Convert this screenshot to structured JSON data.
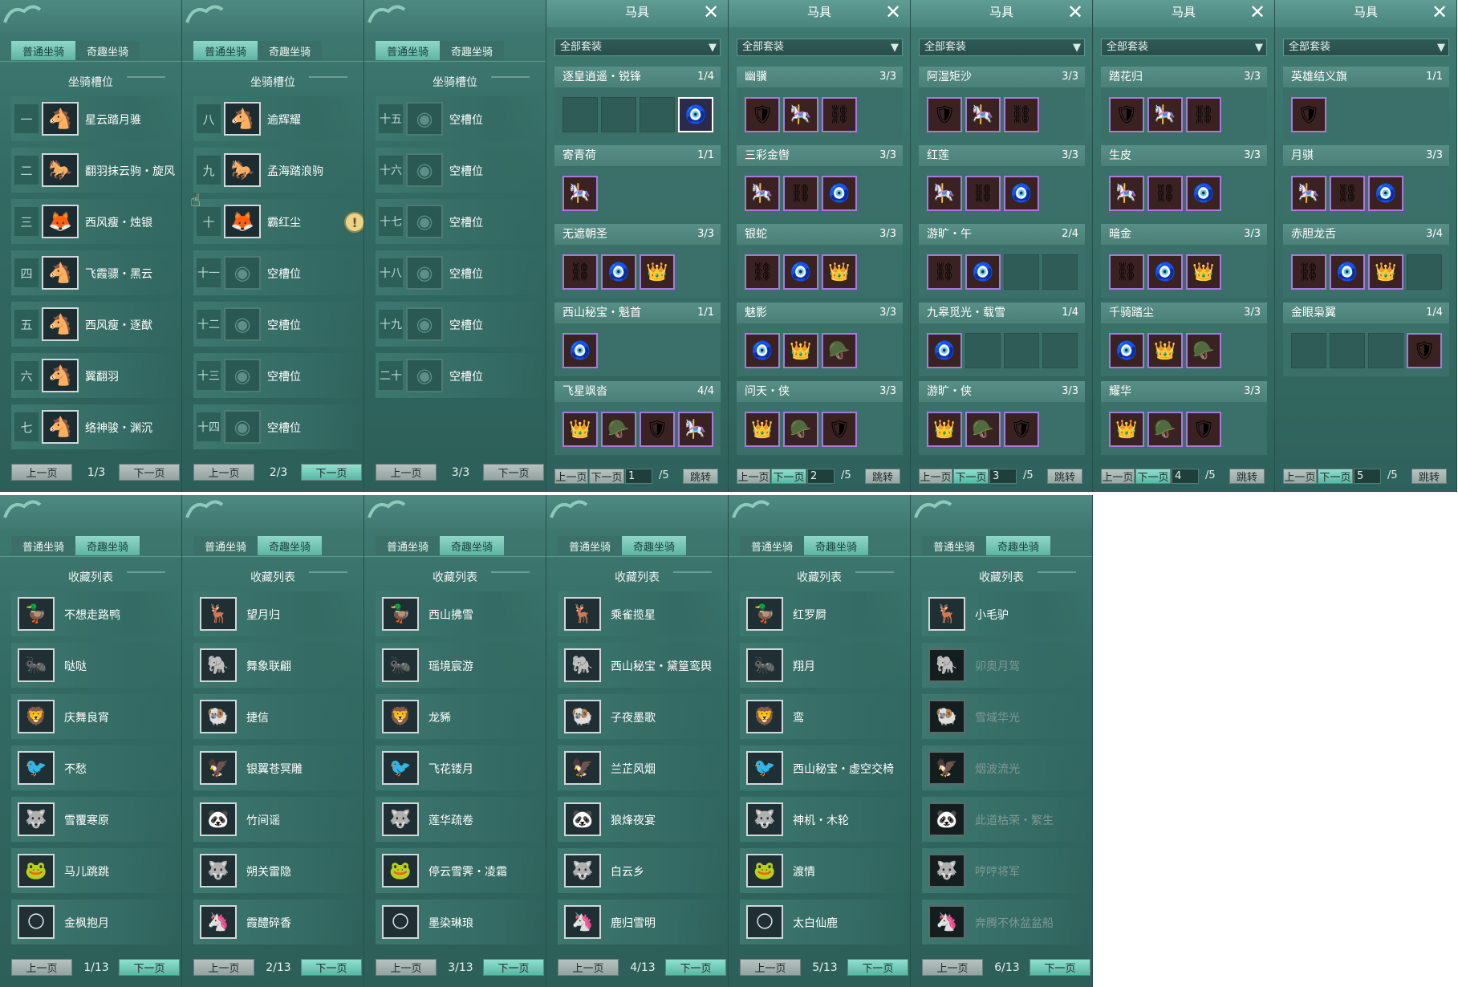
{
  "tabs": {
    "normal": "普通坐骑",
    "fun": "奇趣坐骑"
  },
  "slot_title": "坐骑槽位",
  "collect_title": "收藏列表",
  "prev": "上一页",
  "next": "下一页",
  "goto": "跳转",
  "gear_title": "马具",
  "gear_filter": "全部套装",
  "gear_total": "/5",
  "alert_icon": "!",
  "close_icon": "✕",
  "slot_pages": [
    {
      "page": "1/3",
      "slots": [
        {
          "num": "一",
          "name": "星云踏月骓"
        },
        {
          "num": "二",
          "name": "翻羽抹云驹・旋风"
        },
        {
          "num": "三",
          "name": "西风瘦・烛银"
        },
        {
          "num": "四",
          "name": "飞霞骠・黑云"
        },
        {
          "num": "五",
          "name": "西风瘦・逐猷"
        },
        {
          "num": "六",
          "name": "翼翻羽"
        },
        {
          "num": "七",
          "name": "络神骏・渊沉"
        }
      ]
    },
    {
      "page": "2/3",
      "slots": [
        {
          "num": "八",
          "name": "逾辉耀"
        },
        {
          "num": "九",
          "name": "孟海踏浪驹"
        },
        {
          "num": "十",
          "name": "霸红尘"
        },
        {
          "num": "十一",
          "name": "空槽位"
        },
        {
          "num": "十二",
          "name": "空槽位"
        },
        {
          "num": "十三",
          "name": "空槽位"
        },
        {
          "num": "十四",
          "name": "空槽位"
        }
      ]
    },
    {
      "page": "3/3",
      "slots": [
        {
          "num": "十五",
          "name": "空槽位"
        },
        {
          "num": "十六",
          "name": "空槽位"
        },
        {
          "num": "十七",
          "name": "空槽位"
        },
        {
          "num": "十八",
          "name": "空槽位"
        },
        {
          "num": "十九",
          "name": "空槽位"
        },
        {
          "num": "二十",
          "name": "空槽位"
        }
      ]
    }
  ],
  "gear_pages": [
    {
      "page": "1",
      "sets": [
        {
          "name": "逐皇逍遥・锐锋",
          "count": "1/4"
        },
        {
          "name": "寄青荷",
          "count": "1/1"
        },
        {
          "name": "无遮朝圣",
          "count": "3/3"
        },
        {
          "name": "西山秘宝・魁首",
          "count": "1/1"
        },
        {
          "name": "飞星飒沓",
          "count": "4/4"
        }
      ]
    },
    {
      "page": "2",
      "sets": [
        {
          "name": "幽骥",
          "count": "3/3"
        },
        {
          "name": "三彩金辔",
          "count": "3/3"
        },
        {
          "name": "银蛇",
          "count": "3/3"
        },
        {
          "name": "魅影",
          "count": "3/3"
        },
        {
          "name": "问天・侠",
          "count": "3/3"
        }
      ]
    },
    {
      "page": "3",
      "sets": [
        {
          "name": "阿湿矩沙",
          "count": "3/3"
        },
        {
          "name": "红莲",
          "count": "3/3"
        },
        {
          "name": "游旷・午",
          "count": "2/4"
        },
        {
          "name": "九皋觅光・载雪",
          "count": "1/4"
        },
        {
          "name": "游旷・侠",
          "count": "3/3"
        }
      ]
    },
    {
      "page": "4",
      "sets": [
        {
          "name": "踏花归",
          "count": "3/3"
        },
        {
          "name": "生皮",
          "count": "3/3"
        },
        {
          "name": "暗金",
          "count": "3/3"
        },
        {
          "name": "千骑踏尘",
          "count": "3/3"
        },
        {
          "name": "耀华",
          "count": "3/3"
        }
      ]
    },
    {
      "page": "5",
      "sets": [
        {
          "name": "英雄结义旗",
          "count": "1/1"
        },
        {
          "name": "月骐",
          "count": "3/3"
        },
        {
          "name": "赤胆龙舌",
          "count": "3/4"
        },
        {
          "name": "金眼枭翼",
          "count": "1/4"
        }
      ]
    }
  ],
  "collect_pages": [
    {
      "page": "1/13",
      "items": [
        "不想走路鸭",
        "哒哒",
        "庆舞良宵",
        "不愁",
        "雪覆寒原",
        "马儿跳跳",
        "金枫抱月"
      ]
    },
    {
      "page": "2/13",
      "items": [
        "望月归",
        "舞象联翩",
        "捷信",
        "银翼苍冥雕",
        "竹间谣",
        "朔关雷隐",
        "霞醴碎香"
      ]
    },
    {
      "page": "3/13",
      "items": [
        "西山拂雪",
        "瑶境宸游",
        "龙豨",
        "飞花镂月",
        "莲华疏卷",
        "停云雪霁・凌霜",
        "墨染琳琅"
      ]
    },
    {
      "page": "4/13",
      "items": [
        "乘雀揽星",
        "西山秘宝・黛篁鸾舆",
        "子夜墨歌",
        "兰芷风烟",
        "狼烽夜宴",
        "白云乡",
        "鹿归雪明"
      ]
    },
    {
      "page": "5/13",
      "items": [
        "红罗屙",
        "翔月",
        "鸾",
        "西山秘宝・虚空交椅",
        "神机・木轮",
        "渡情",
        "太白仙鹿"
      ]
    },
    {
      "page": "6/13",
      "items": [
        "小毛驴",
        "卯奥月驾",
        "雪域华光",
        "烟波流光",
        "此道枯荣・繁生",
        "哼哼将军",
        "奔腾不休盆盆船"
      ]
    }
  ]
}
